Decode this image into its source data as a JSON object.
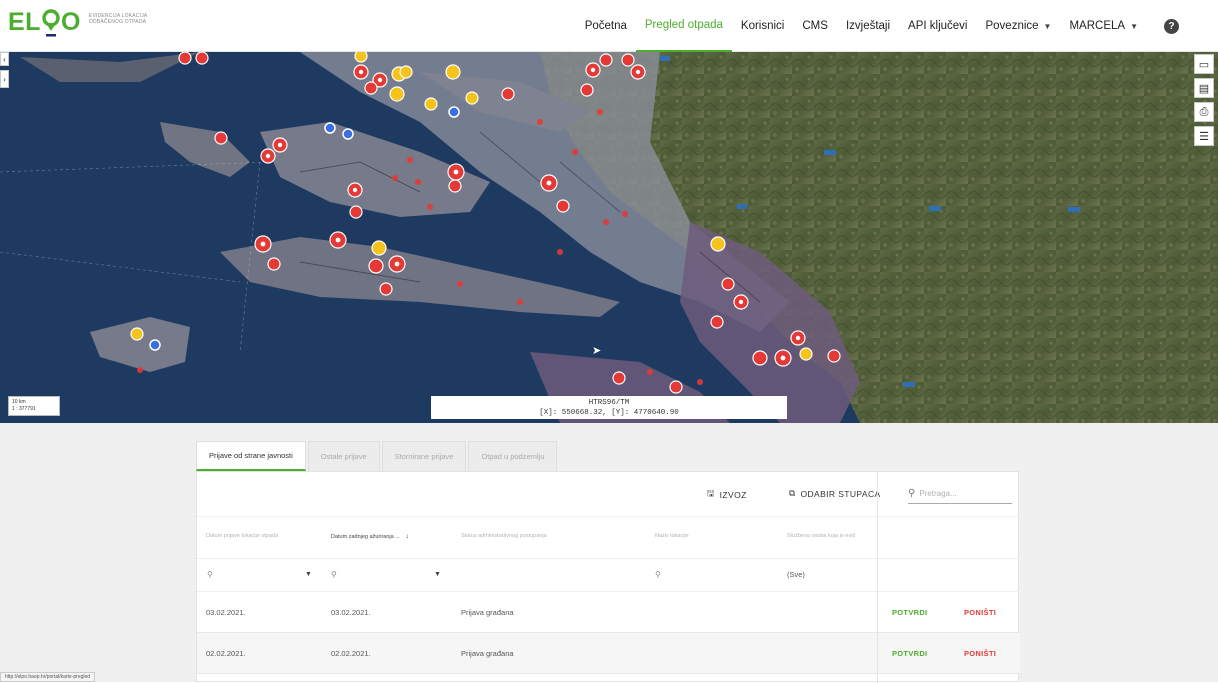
{
  "header": {
    "logo_text_left": "EL",
    "logo_text_right": "O",
    "logo_subtitle": "EVIDENCIJA LOKACIJA ODBAČENOG OTPADA",
    "nav": [
      {
        "label": "Početna",
        "active": false,
        "dropdown": false
      },
      {
        "label": "Pregled otpada",
        "active": true,
        "dropdown": false
      },
      {
        "label": "Korisnici",
        "active": false,
        "dropdown": false
      },
      {
        "label": "CMS",
        "active": false,
        "dropdown": false
      },
      {
        "label": "Izvještaji",
        "active": false,
        "dropdown": false
      },
      {
        "label": "API ključevi",
        "active": false,
        "dropdown": false
      },
      {
        "label": "Poveznice",
        "active": false,
        "dropdown": true
      },
      {
        "label": "MARCELA",
        "active": false,
        "dropdown": true
      }
    ],
    "help_icon": "?"
  },
  "map": {
    "projection": "HTRS96/TM",
    "coordinates": "[X]: 550668.32, [Y]: 4770640.90",
    "scale_distance": "10 km",
    "scale_ratio": "1 : 377791",
    "tools": [
      "layers-icon",
      "legend-icon",
      "print-icon",
      "list-icon"
    ]
  },
  "tabs": [
    {
      "label": "Prijave od strane javnosti",
      "active": true
    },
    {
      "label": "Ostale prijave",
      "active": false
    },
    {
      "label": "Stornirane prijave",
      "active": false
    },
    {
      "label": "Otpad u podzemlju",
      "active": false
    }
  ],
  "toolbar": {
    "export_label": "IZVOZ",
    "columns_label": "ODABIR STUPACA",
    "search_placeholder": "Pretraga..."
  },
  "columns": [
    "Datum prijave lokacije otpada",
    "Datum zadnjeg ažuriranja ...",
    "Status administrativnog postupanja",
    "Naziv lokacije",
    "Službena osoba koja je evid"
  ],
  "filter": {
    "status_value": "(Sve)"
  },
  "rows": [
    {
      "date_reported": "03.02.2021.",
      "date_updated": "03.02.2021.",
      "status": "Prijava građana",
      "location": "",
      "official": "",
      "confirm": "POTVRDI",
      "cancel": "PONIŠTI"
    },
    {
      "date_reported": "02.02.2021.",
      "date_updated": "02.02.2021.",
      "status": "Prijava građana",
      "location": "",
      "official": "",
      "confirm": "POTVRDI",
      "cancel": "PONIŠTI"
    }
  ],
  "statusbar_url": "http://elpo.haop.hr/portal/karte-pregled",
  "colors": {
    "brand_green": "#4cae2e",
    "cancel_red": "#e23b3b",
    "marker_red": "#e53935",
    "marker_yellow": "#f6c21c",
    "marker_blue": "#3b6fe0"
  }
}
